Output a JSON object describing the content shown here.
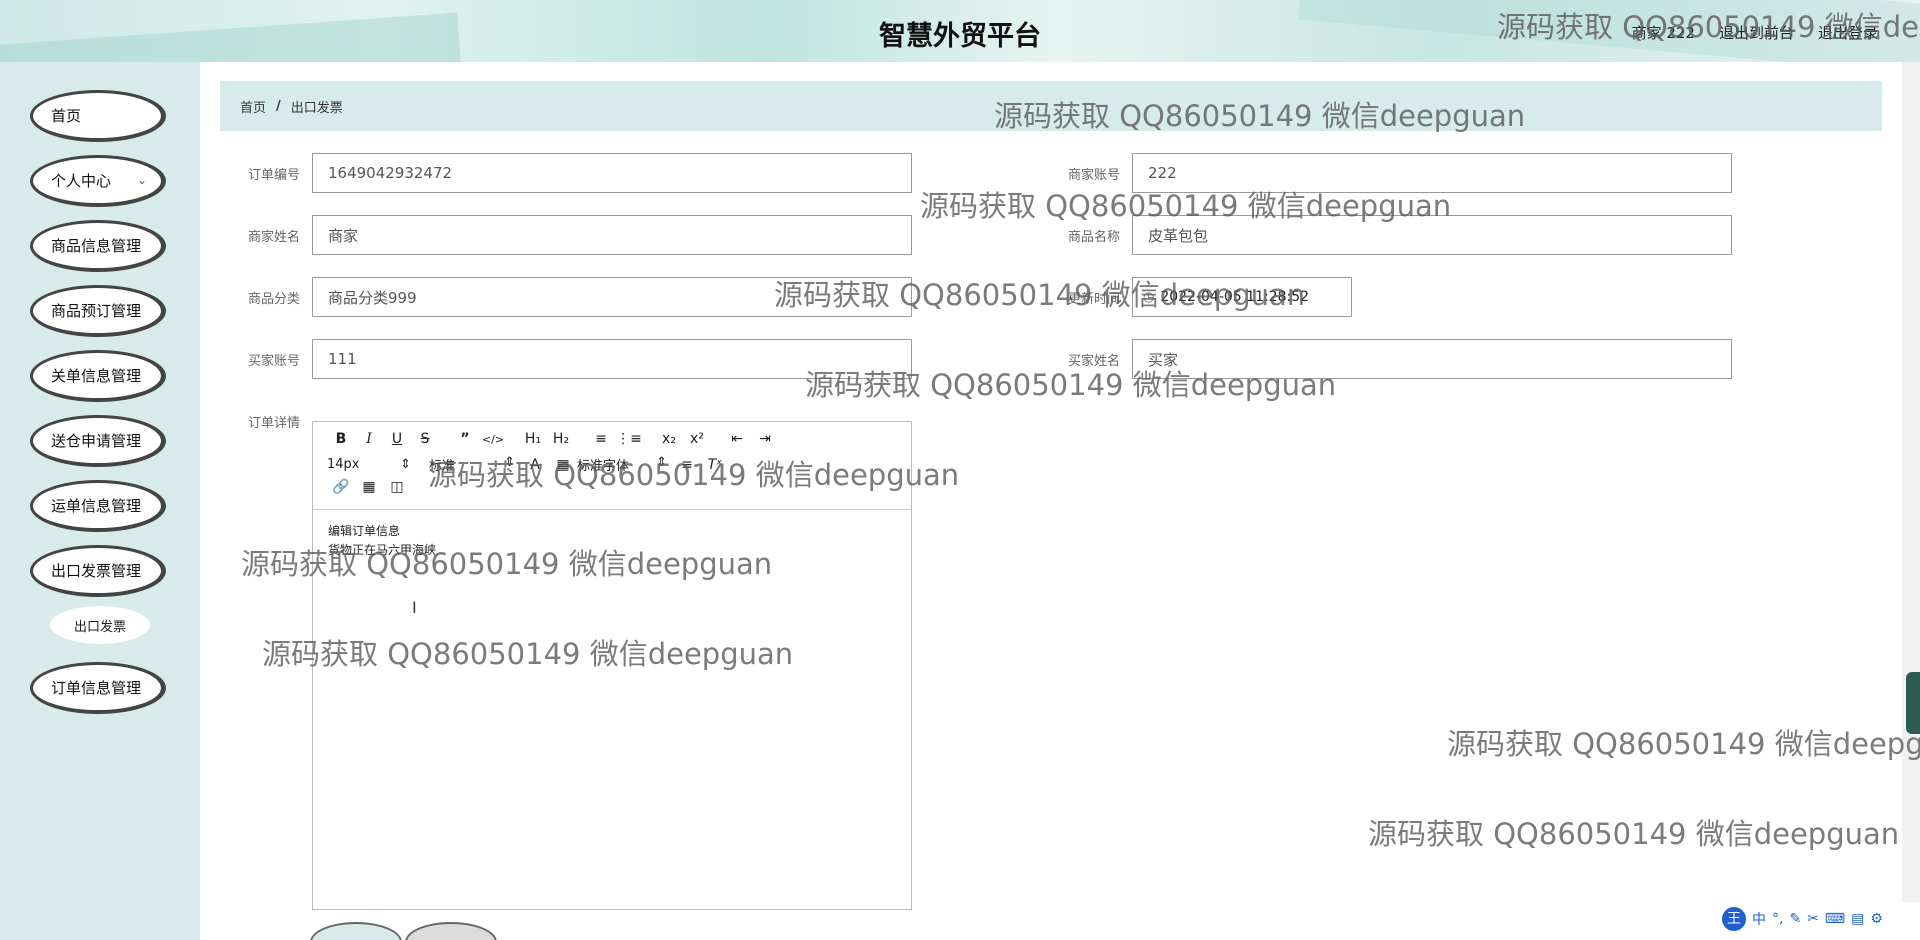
{
  "header": {
    "title": "智慧外贸平台",
    "user": "商家 222",
    "back_to_front": "退出到前台",
    "logout": "退出登录"
  },
  "sidebar": {
    "items": [
      {
        "label": "首页"
      },
      {
        "label": "个人中心"
      },
      {
        "label": "商品信息管理"
      },
      {
        "label": "商品预订管理"
      },
      {
        "label": "关单信息管理"
      },
      {
        "label": "送仓申请管理"
      },
      {
        "label": "运单信息管理"
      },
      {
        "label": "出口发票管理"
      },
      {
        "label": "订单信息管理"
      }
    ],
    "sub_item": "出口发票"
  },
  "breadcrumb": {
    "home": "首页",
    "sep": "/",
    "current": "出口发票"
  },
  "form": {
    "order_no_label": "订单编号",
    "order_no": "1649042932472",
    "merchant_account_label": "商家账号",
    "merchant_account": "222",
    "merchant_name_label": "商家姓名",
    "merchant_name": "商家",
    "product_name_label": "商品名称",
    "product_name": "皮革包包",
    "category_label": "商品分类",
    "category": "商品分类999",
    "update_time_label": "更新时间",
    "update_time": "2022-04-05 11:28:52",
    "buyer_account_label": "买家账号",
    "buyer_account": "111",
    "buyer_name_label": "买家姓名",
    "buyer_name": "买家",
    "details_label": "订单详情"
  },
  "editor": {
    "font_size": "14px",
    "font_family": "标准字体",
    "heading": "标准",
    "content_line1": "编辑订单信息",
    "content_line2": "货物正在马六甲海峡"
  },
  "watermark": "源码获取 QQ86050149 微信deepguan",
  "ime": {
    "label1": "中",
    "label2": "°,"
  }
}
